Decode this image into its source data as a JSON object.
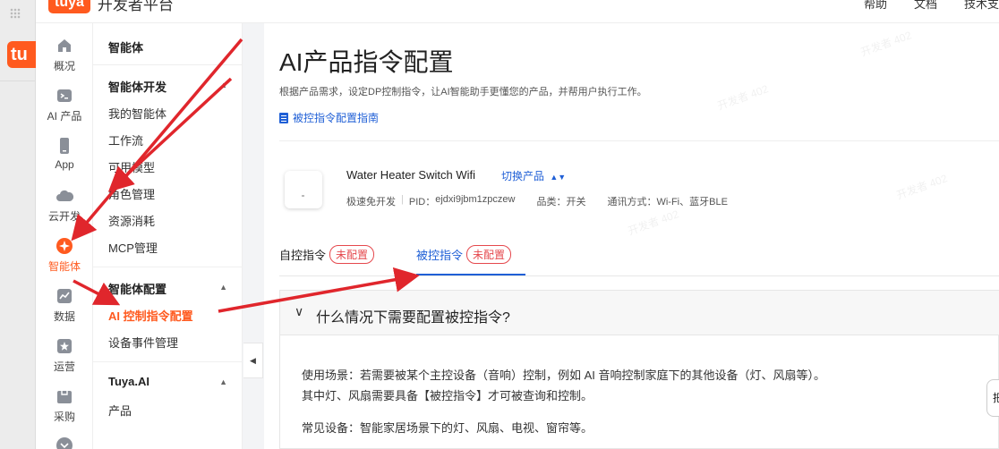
{
  "brand": {
    "logo": "tuya",
    "name": "开发者平台"
  },
  "top_links": [
    "帮助",
    "文档",
    "技术支"
  ],
  "iconbar": [
    {
      "label": "概况",
      "icon": "home-icon"
    },
    {
      "label": "AI 产品",
      "icon": "terminal-icon"
    },
    {
      "label": "App",
      "icon": "phone-icon"
    },
    {
      "label": "云开发",
      "icon": "cloud-icon"
    },
    {
      "label": "智能体",
      "icon": "agent-icon",
      "active": true
    },
    {
      "label": "数据",
      "icon": "chart-icon"
    },
    {
      "label": "运营",
      "icon": "star-icon"
    },
    {
      "label": "采购",
      "icon": "cart-icon"
    }
  ],
  "submenu": {
    "title": "智能体",
    "groups": [
      {
        "label": "智能体开发",
        "items": [
          "我的智能体",
          "工作流",
          "可用模型",
          "角色管理",
          "资源消耗",
          "MCP管理"
        ]
      },
      {
        "label": "智能体配置",
        "items": [
          "AI 控制指令配置",
          "设备事件管理"
        ],
        "active_item": "AI 控制指令配置"
      },
      {
        "label": "Tuya.AI",
        "items": [
          "产品"
        ]
      }
    ]
  },
  "main": {
    "title": "AI产品指令配置",
    "desc": "根据产品需求，设定DP控制指令，让AI智能助手更懂您的产品，并帮用户执行工作。",
    "guide_link": "被控指令配置指南",
    "product": {
      "name": "Water Heater Switch Wifi",
      "switch_label": "切换产品",
      "mode": "极速免开发",
      "pid_label": "PID：",
      "pid": "ejdxi9jbm1zpczew",
      "category": "品类：开关",
      "comm": "通讯方式：Wi-Fi、蓝牙BLE"
    },
    "tabs": [
      {
        "label": "自控指令",
        "badge": "未配置"
      },
      {
        "label": "被控指令",
        "badge": "未配置",
        "active": true
      }
    ],
    "faq": {
      "question": "什么情况下需要配置被控指令?",
      "lines": [
        "使用场景：若需要被某个主控设备（音响）控制，例如 AI 音响控制家庭下的其他设备（灯、风扇等）。",
        "其中灯、风扇需要具备【被控指令】才可被查询和控制。",
        "常见设备：智能家居场景下的灯、风扇、电视、窗帘等。"
      ]
    },
    "help_widget": "把"
  },
  "colors": {
    "accent": "#ff5a1f",
    "link": "#1f5fd6",
    "annotation": "#e0262c"
  }
}
